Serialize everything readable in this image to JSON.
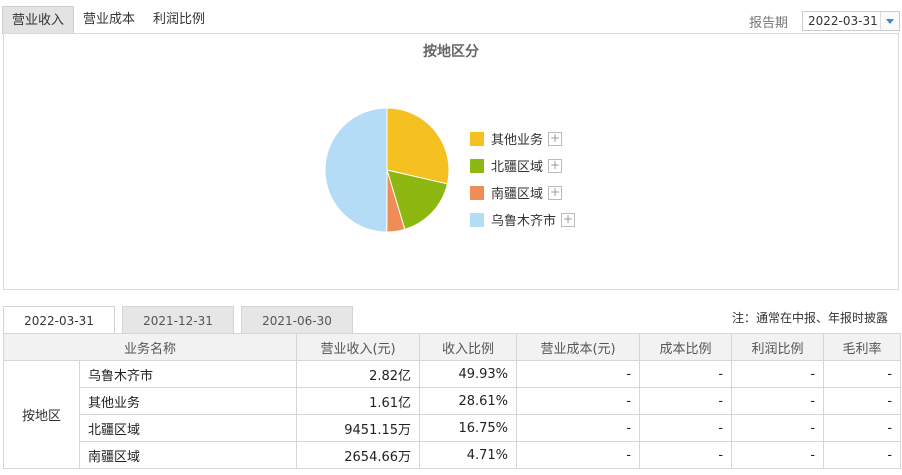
{
  "top_tabs": [
    {
      "label": "营业收入",
      "active": true
    },
    {
      "label": "营业成本",
      "active": false
    },
    {
      "label": "利润比例",
      "active": false
    }
  ],
  "report": {
    "label": "报告期",
    "value": "2022-03-31"
  },
  "chart_data": {
    "type": "pie",
    "title": "按地区分",
    "series": [
      {
        "name": "其他业务",
        "value": 28.61,
        "color": "#f4c120"
      },
      {
        "name": "北疆区域",
        "value": 16.75,
        "color": "#8db812"
      },
      {
        "name": "南疆区域",
        "value": 4.71,
        "color": "#f08d56"
      },
      {
        "name": "乌鲁木齐市",
        "value": 49.93,
        "color": "#b4dcf7"
      }
    ],
    "legend_position": "right"
  },
  "legend_plus": "+",
  "period_tabs": [
    {
      "label": "2022-03-31",
      "active": true
    },
    {
      "label": "2021-12-31",
      "active": false
    },
    {
      "label": "2021-06-30",
      "active": false
    }
  ],
  "note": "注：通常在中报、年报时披露",
  "table": {
    "headers": [
      "业务名称",
      "营业收入(元)",
      "收入比例",
      "营业成本(元)",
      "成本比例",
      "利润比例",
      "毛利率"
    ],
    "group": "按地区",
    "rows": [
      {
        "name": "乌鲁木齐市",
        "revenue": "2.82亿",
        "ratio": "49.93%",
        "cost": "-",
        "cost_ratio": "-",
        "profit_ratio": "-",
        "margin": "-"
      },
      {
        "name": "其他业务",
        "revenue": "1.61亿",
        "ratio": "28.61%",
        "cost": "-",
        "cost_ratio": "-",
        "profit_ratio": "-",
        "margin": "-"
      },
      {
        "name": "北疆区域",
        "revenue": "9451.15万",
        "ratio": "16.75%",
        "cost": "-",
        "cost_ratio": "-",
        "profit_ratio": "-",
        "margin": "-"
      },
      {
        "name": "南疆区域",
        "revenue": "2654.66万",
        "ratio": "4.71%",
        "cost": "-",
        "cost_ratio": "-",
        "profit_ratio": "-",
        "margin": "-"
      }
    ]
  }
}
